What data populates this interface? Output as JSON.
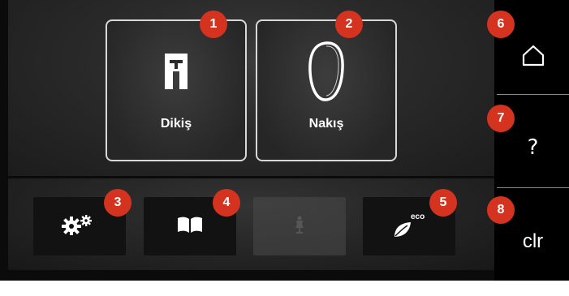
{
  "modes": {
    "sewing_label": "Dikiş",
    "embroidery_label": "Nakış"
  },
  "toolbar": {
    "buttons": [
      "setup",
      "tutorial",
      "stitch-guide",
      "eco"
    ],
    "eco_text": "eco"
  },
  "sidebar": {
    "home_icon": "home-icon",
    "help_icon": "help-icon",
    "clear_label": "clr"
  },
  "callouts": [
    "1",
    "2",
    "3",
    "4",
    "5",
    "6",
    "7",
    "8"
  ],
  "colors": {
    "callout": "#d4331f",
    "background": "#0b0b0b",
    "card_border": "#d8d8d8",
    "text": "#ffffff"
  }
}
